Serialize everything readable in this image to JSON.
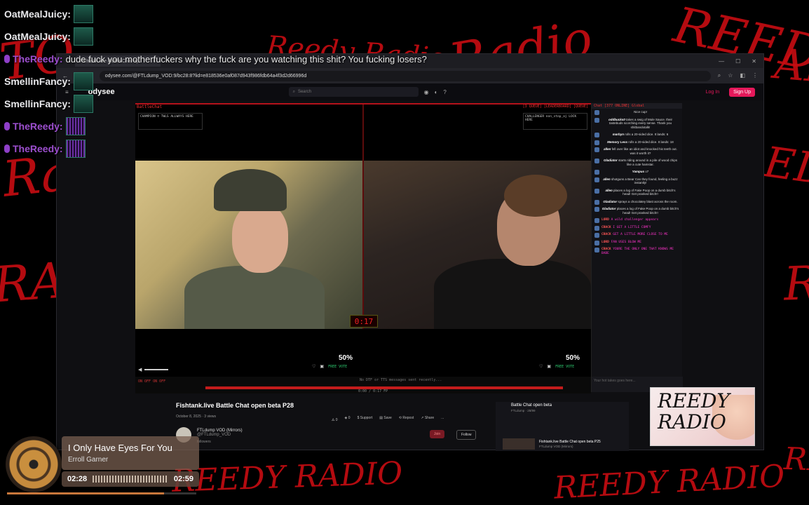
{
  "overlay_chat": [
    {
      "user": "OatMealJuicy:",
      "text": "",
      "avatar": "video-thumb"
    },
    {
      "user": "OatMealJuicy:",
      "text": "",
      "avatar": "video-thumb"
    },
    {
      "user": "TheReedy:",
      "text": "dude fuck you motherfuckers why the fuck are you watching this shit? You fucking losers?",
      "avatar": "mic"
    },
    {
      "user": "SmellinFancy:",
      "text": "",
      "avatar": "video-thumb"
    },
    {
      "user": "SmellinFancy:",
      "text": "",
      "avatar": "video-thumb"
    },
    {
      "user": "TheReedy:",
      "text": "",
      "avatar": "equalizer"
    },
    {
      "user": "TheReedy:",
      "text": "",
      "avatar": "equalizer"
    }
  ],
  "browser": {
    "tab_title": "Fishtank.live Battle Chat op",
    "url": "odysee.com/@FTLdump_VOD:9/bc28:8?lid=e818536e0af087d943f986fdb64a4f3d2d66996d"
  },
  "site": {
    "logo": "odysee",
    "search_placeholder": "Search",
    "login": "Log In",
    "signup": "Sign Up"
  },
  "video": {
    "left_label": "BattleChat",
    "right_label": "[3 QUEUE] [LEADERBOARD] [QUEUE]",
    "left_box": "CHAMPION ☺  TWLS  ALLWAYS HERE",
    "right_box": "CHALLENGER  non_stop_aj  LOCK HERE",
    "timer": "0:17",
    "left_pct": "50%",
    "right_pct": "50%",
    "free_vote": "FREE VOTE",
    "ticker_info": "ON OFF ON OFF",
    "ticker_mid": "No DTF or TTS messages sent recently...",
    "ticker_time": "0:00 / 0:17 FP"
  },
  "chat": {
    "header": "Chat [377 ONLINE]  Global",
    "messages": [
      {
        "who": "",
        "text": "Nice cup!",
        "type": "sys"
      },
      {
        "who": "oddbucks0",
        "text": "takes a swig of Mule Sauce. their tastebuds scorching every sense. Thank you shitbandotalk!",
        "type": "sys"
      },
      {
        "who": "marbyn",
        "text": "rolls a 20-sided dice. It lands: 6",
        "type": "sys"
      },
      {
        "who": "Memory Less",
        "text": "rolls a 20-sided dice. It lands: 18",
        "type": "sys"
      },
      {
        "who": "allen",
        "text": "fell over like an idiot and knocked his teeth out. was it worth it?",
        "type": "sys"
      },
      {
        "who": "Gladiator",
        "text": "starts riding around in a pile of wood chips like a cute hamstar.",
        "type": "sys"
      },
      {
        "who": "Yampus",
        "text": "o7",
        "type": "sys"
      },
      {
        "who": "allen",
        "text": "shotguns a Bear Can they found, feeling a buzz instantly!",
        "type": "sys"
      },
      {
        "who": "allen",
        "text": "places a log of Fake Poop on a dumb bitch's head! Get pranked bitch!!",
        "type": "sys"
      },
      {
        "who": "Gladiator",
        "text": "sprays a chocolatey blast across the room.",
        "type": "sys"
      },
      {
        "who": "Gladiator",
        "text": "places a log of Fake Poop on a dumb bitch's head! Get pranked bitch!!",
        "type": "sys"
      },
      {
        "who": "LORD",
        "text": "A wild challenger appears",
        "type": "term"
      },
      {
        "who": "CRACK",
        "text": "I GET A LITTLE COMFY",
        "type": "term"
      },
      {
        "who": "CRACK",
        "text": "GET A LITTLE MORE CLOSE TO ME",
        "type": "term"
      },
      {
        "who": "LORD",
        "text": "FAN USES BLOW ME",
        "type": "term"
      },
      {
        "who": "CRACK",
        "text": "YOURE THE ONLY ONE THAT KNOWS ME BABE",
        "type": "term"
      }
    ],
    "input_placeholder": "Your hot takes goes here..."
  },
  "below": {
    "title": "Fishtank.live Battle Chat open beta P28",
    "meta": "October 8, 2025  ·  3 views",
    "channel": "FTLdump VOD (Mirrors)",
    "channel_handle": "@FTLdump_VOD",
    "followers": "followers",
    "actions": [
      "0",
      "0",
      "Support",
      "Save",
      "Repost",
      "Share",
      "..."
    ],
    "join": "Join",
    "follow": "Follow"
  },
  "playlist": {
    "title": "Battle Chat open beta",
    "sub": "FTLdump · 28/99",
    "item_title": "Fishtank.live Battle Chat open beta P25",
    "item_sub": "FTLdump VOD (Mirrors)",
    "item_time": "07:33:57"
  },
  "reedy_card": {
    "text": "REEDY RADIO"
  },
  "now_playing": {
    "title": "I Only Have Eyes For You",
    "artist": "Erroll Garner",
    "elapsed": "02:28",
    "total": "02:59",
    "progress": 0.83
  },
  "graffiti": [
    "Ra",
    "RAD",
    "EDY",
    "RA",
    "Radio",
    "REEDY",
    "REEDY RADIO",
    "REEDY RADIO",
    "RE",
    "AD",
    "TO",
    "Reedy Radio"
  ],
  "colors": {
    "accent": "#e4185a",
    "stream_red": "#c80d12"
  }
}
